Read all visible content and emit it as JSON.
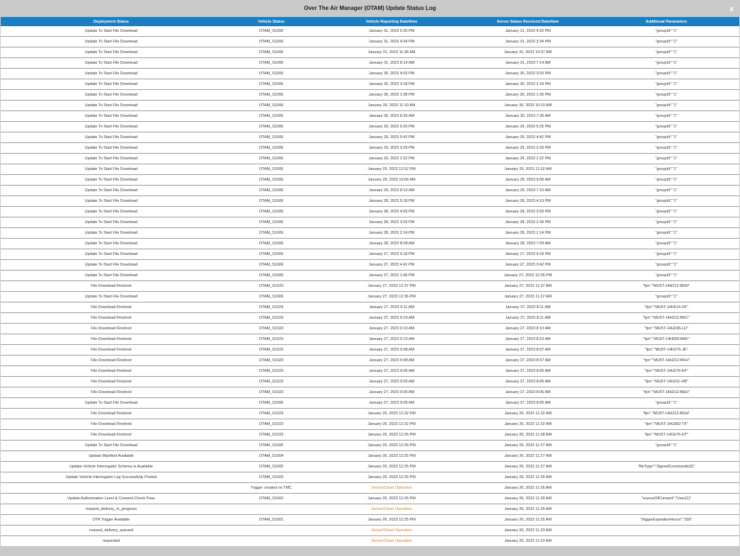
{
  "dialog": {
    "title": "Over The Air Manager (OTAM) Update Status Log",
    "close_label": "x"
  },
  "table": {
    "columns": [
      "Deployment Status",
      "Vehicle Status",
      "Vehicle Reporting Date/time",
      "Server Status Received Date/time",
      "Additional Parameters"
    ],
    "rows": [
      [
        "Update To Start File Download",
        "OTAM_S1006",
        "January 31, 2023 5:20 PM",
        "January 31, 2023 4:20 PM",
        "\"groupId\":\"1\""
      ],
      [
        "Update To Start File Download",
        "OTAM_S1006",
        "January 31, 2023 4:34 PM",
        "January 31, 2023 3:34 PM",
        "\"groupId\":\"1\""
      ],
      [
        "Update To Start File Download",
        "OTAM_S1006",
        "January 31, 2023 11:36 AM",
        "January 31, 2023 10:37 AM",
        "\"groupId\":\"1\""
      ],
      [
        "Update To Start File Download",
        "OTAM_S1006",
        "January 31, 2023 8:14 AM",
        "January 31, 2023 7:14 AM",
        "\"groupId\":\"1\""
      ],
      [
        "Update To Start File Download",
        "OTAM_S1006",
        "January 30, 2023 4:03 PM",
        "January 30, 2023 3:03 PM",
        "\"groupId\":\"1\""
      ],
      [
        "Update To Start File Download",
        "OTAM_S1006",
        "January 30, 2023 3:18 PM",
        "January 30, 2023 2:18 PM",
        "\"groupId\":\"1\""
      ],
      [
        "Update To Start File Download",
        "OTAM_S1006",
        "January 30, 2023 2:38 PM",
        "January 30, 2023 1:39 PM",
        "\"groupId\":\"1\""
      ],
      [
        "Update To Start File Download",
        "OTAM_S1006",
        "January 30, 2023 11:10 AM",
        "January 30, 2023 10:10 AM",
        "\"groupId\":\"1\""
      ],
      [
        "Update To Start File Download",
        "OTAM_S1006",
        "January 30, 2023 8:35 AM",
        "January 30, 2023 7:35 AM",
        "\"groupId\":\"1\""
      ],
      [
        "Update To Start File Download",
        "OTAM_S1006",
        "January 29, 2023 6:25 PM",
        "January 29, 2023 5:25 PM",
        "\"groupId\":\"1\""
      ],
      [
        "Update To Start File Download",
        "OTAM_S1006",
        "January 29, 2023 5:42 PM",
        "January 29, 2023 4:42 PM",
        "\"groupId\":\"1\""
      ],
      [
        "Update To Start File Download",
        "OTAM_S1006",
        "January 29, 2023 3:29 PM",
        "January 29, 2023 2:29 PM",
        "\"groupId\":\"1\""
      ],
      [
        "Update To Start File Download",
        "OTAM_S1006",
        "January 29, 2023 2:22 PM",
        "January 29, 2023 1:22 PM",
        "\"groupId\":\"1\""
      ],
      [
        "Update To Start File Download",
        "OTAM_S1006",
        "January 29, 2023 12:52 PM",
        "January 29, 2023 11:52 AM",
        "\"groupId\":\"1\""
      ],
      [
        "Update To Start File Download",
        "OTAM_S1006",
        "January 29, 2023 10:06 AM",
        "January 29, 2023 9:06 AM",
        "\"groupId\":\"1\""
      ],
      [
        "Update To Start File Download",
        "OTAM_S1006",
        "January 29, 2023 8:10 AM",
        "January 29, 2023 7:10 AM",
        "\"groupId\":\"1\""
      ],
      [
        "Update To Start File Download",
        "OTAM_S1006",
        "January 28, 2023 5:18 PM",
        "January 28, 2023 4:19 PM",
        "\"groupId\":\"1\""
      ],
      [
        "Update To Start File Download",
        "OTAM_S1006",
        "January 28, 2023 4:59 PM",
        "January 28, 2023 3:59 PM",
        "\"groupId\":\"1\""
      ],
      [
        "Update To Start File Download",
        "OTAM_S1006",
        "January 28, 2023 3:33 PM",
        "January 28, 2023 2:34 PM",
        "\"groupId\":\"1\""
      ],
      [
        "Update To Start File Download",
        "OTAM_S1006",
        "January 28, 2023 2:14 PM",
        "January 28, 2023 1:14 PM",
        "\"groupId\":\"1\""
      ],
      [
        "Update To Start File Download",
        "OTAM_S1006",
        "January 28, 2023 8:08 AM",
        "January 28, 2023 7:09 AM",
        "\"groupId\":\"1\""
      ],
      [
        "Update To Start File Download",
        "OTAM_S1006",
        "January 27, 2023 5:18 PM",
        "January 27, 2023 4:18 PM",
        "\"groupId\":\"1\""
      ],
      [
        "Update To Start File Download",
        "OTAM_S1006",
        "January 27, 2023 4:41 PM",
        "January 27, 2023 3:42 PM",
        "\"groupId\":\"1\""
      ],
      [
        "Update To Start File Download",
        "OTAM_S1006",
        "January 27, 2023 1:36 PM",
        "January 27, 2023 12:36 PM",
        "\"groupId\":\"1\""
      ],
      [
        "File Download Finished",
        "OTAM_S1023",
        "January 27, 2023 12:37 PM",
        "January 27, 2023 11:37 AM",
        "\"fpn\":\"MU5T-14H212-BDH\""
      ],
      [
        "Update To Start File Download",
        "OTAM_S1006",
        "January 27, 2023 12:36 PM",
        "January 27, 2023 11:37 AM",
        "\"groupId\":\"1\""
      ],
      [
        "File Download Finished",
        "OTAM_S1023",
        "January 27, 2023 9:11 AM",
        "January 27, 2023 8:11 AM",
        "\"fpn\":\"MU5T-14H214-XF\""
      ],
      [
        "File Download Finished",
        "OTAM_S1023",
        "January 27, 2023 9:10 AM",
        "January 27, 2023 8:11 AM",
        "\"fpn\":\"MU5T-14H212-BKC\""
      ],
      [
        "File Download Finished",
        "OTAM_S1023",
        "January 27, 2023 9:10 AM",
        "January 27, 2023 8:10 AM",
        "\"fpn\":\"MU5T-14H236-LD\""
      ],
      [
        "File Download Finished",
        "OTAM_S1023",
        "January 27, 2023 9:10 AM",
        "January 27, 2023 8:10 AM",
        "\"fpn\":\"MU5T-14H009-BAF\""
      ],
      [
        "File Download Finished",
        "OTAM_S1023",
        "January 27, 2023 9:08 AM",
        "January 27, 2023 8:07 AM",
        "\"fpn\":\"MU5T-14H276-JE\""
      ],
      [
        "File Download Finished",
        "OTAM_S1023",
        "January 27, 2023 9:08 AM",
        "January 27, 2023 8:07 AM",
        "\"fpn\":\"MU5T-14H212-BFH\""
      ],
      [
        "File Download Finished",
        "OTAM_S1023",
        "January 27, 2023 9:06 AM",
        "January 27, 2023 8:06 AM",
        "\"fpn\":\"MU5T-14H276-KF\""
      ],
      [
        "File Download Finished",
        "OTAM_S1023",
        "January 27, 2023 9:05 AM",
        "January 27, 2023 8:06 AM",
        "\"fpn\":\"MU5T-14H211-HB\""
      ],
      [
        "File Download Finished",
        "OTAM_S1023",
        "January 27, 2023 9:05 AM",
        "January 27, 2023 8:06 AM",
        "\"fpn\":\"MU5T-14H212-BEH\""
      ],
      [
        "Update To Start File Download",
        "OTAM_S1006",
        "January 27, 2023 9:05 AM",
        "January 27, 2023 8:05 AM",
        "\"groupId\":\"1\""
      ],
      [
        "File Download Finished",
        "OTAM_S1023",
        "January 26, 2023 12:32 PM",
        "January 26, 2023 11:32 AM",
        "\"fpn\":\"MU5T-14H212-BGH\""
      ],
      [
        "File Download Finished",
        "OTAM_S1023",
        "January 26, 2023 12:32 PM",
        "January 26, 2023 11:32 AM",
        "\"fpn\":\"MU5T-14G682-TF\""
      ],
      [
        "File Download Finished",
        "OTAM_S1023",
        "January 26, 2023 12:26 PM",
        "January 26, 2023 11:28 AM",
        "\"fpn\":\"MU5T-14G676-DT\""
      ],
      [
        "Update To Start File Download",
        "OTAM_S1006",
        "January 26, 2023 12:26 PM",
        "January 26, 2023 11:27 AM",
        "\"groupId\":\"1\""
      ],
      [
        "Update Manifest Available",
        "OTAM_S1004",
        "January 26, 2023 12:25 PM",
        "January 26, 2023 11:27 AM",
        ""
      ],
      [
        "Update Vehicle Interrogator Schema Is Available",
        "OTAM_S1005",
        "January 26, 2023 12:25 PM",
        "January 26, 2023 11:27 AM",
        "\"fileType\":\"SignedCommands(3)\""
      ],
      [
        "Update Vehicle Interrogator Log Successfully Posted",
        "OTAM_S1003",
        "January 26, 2023 12:25 PM",
        "January 26, 2023 11:26 AM",
        ""
      ],
      [
        "",
        "Trigger created on TMC",
        "Server/Cloud Operation",
        "January 26, 2023 11:26 AM",
        ""
      ],
      [
        "Update Authorization Level & Consent Check Pass",
        "OTAM_S1002",
        "January 26, 2023 12:25 PM",
        "January 26, 2023 11:26 AM",
        "\"sourceOfConsent\":\"User(1)\""
      ],
      [
        "request_delivery_in_progress",
        "",
        "Server/Cloud Operation",
        "January 26, 2023 11:25 AM",
        ""
      ],
      [
        "OTA Trigger Available",
        "OTAM_S1001",
        "January 26, 2023 12:25 PM",
        "January 26, 2023 11:25 AM",
        "\"triggerExpirationHours\":\"336\""
      ],
      [
        "request_delivery_queued",
        "",
        "Server/Cloud Operation",
        "January 26, 2023 11:23 AM",
        ""
      ],
      [
        "requested",
        "",
        "Server/Cloud Operation",
        "January 26, 2023 11:23 AM",
        ""
      ]
    ]
  },
  "colors": {
    "header_bg": "#1a7ec2",
    "frame_bg": "#c9c9c9",
    "server_op_text": "#e07a1c"
  }
}
